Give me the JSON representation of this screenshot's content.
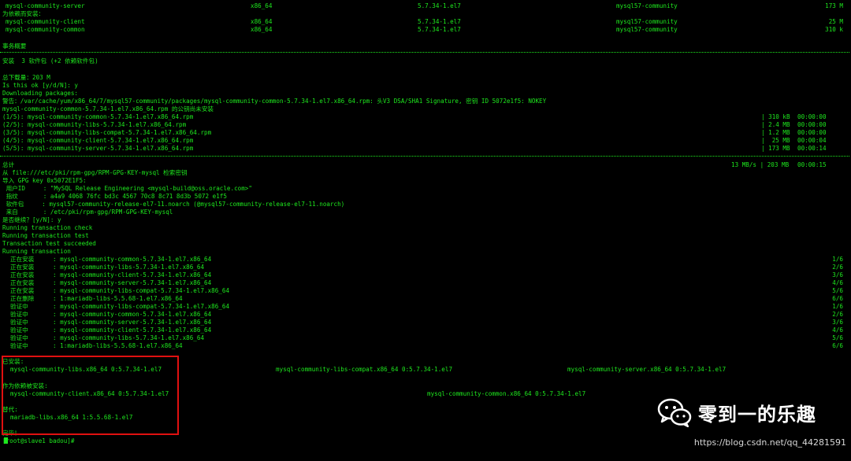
{
  "terminal": {
    "top_rows": [
      {
        "name": "mysql-community-server",
        "arch": "x86_64",
        "version": "5.7.34-1.el7",
        "repo": "mysql57-community",
        "size": "173 M"
      },
      {
        "section": "为依赖而安装："
      },
      {
        "name": "mysql-community-client",
        "arch": "x86_64",
        "version": "5.7.34-1.el7",
        "repo": "mysql57-community",
        "size": "25 M"
      },
      {
        "name": "mysql-community-common",
        "arch": "x86_64",
        "version": "5.7.34-1.el7",
        "repo": "mysql57-community",
        "size": "310 k"
      }
    ],
    "summary_title": "事务概要",
    "install_summary": "安装  3 软件包 (+2 依赖软件包)",
    "prelude": [
      "总下载量：203 M",
      "Is this ok [y/d/N]: y",
      "Downloading packages:",
      "警告：/var/cache/yum/x86_64/7/mysql57-community/packages/mysql-community-common-5.7.34-1.el7.x86_64.rpm: 头V3 DSA/SHA1 Signature, 密钥 ID 5072e1f5: NOKEY",
      "mysql-community-common-5.7.34-1.el7.x86_64.rpm 的公钥尚未安装"
    ],
    "downloads": [
      {
        "file": "(1/5): mysql-community-common-5.7.34-1.el7.x86_64.rpm",
        "size": "| 310 kB",
        "time": "00:00:00"
      },
      {
        "file": "(2/5): mysql-community-libs-5.7.34-1.el7.x86_64.rpm",
        "size": "| 2.4 MB",
        "time": "00:00:00"
      },
      {
        "file": "(3/5): mysql-community-libs-compat-5.7.34-1.el7.x86_64.rpm",
        "size": "| 1.2 MB",
        "time": "00:00:00"
      },
      {
        "file": "(4/5): mysql-community-client-5.7.34-1.el7.x86_64.rpm",
        "size": "|  25 MB",
        "time": "00:00:04"
      },
      {
        "file": "(5/5): mysql-community-server-5.7.34-1.el7.x86_64.rpm",
        "size": "| 173 MB",
        "time": "00:00:14"
      }
    ],
    "total": {
      "label": "总计",
      "size": "13 MB/s | 203 MB",
      "time": "00:00:15"
    },
    "gpg_lines": [
      "从 file:///etc/pki/rpm-gpg/RPM-GPG-KEY-mysql 检索密钥",
      "导入 GPG key 0x5072E1F5:",
      " 用户ID     : \"MySQL Release Engineering <mysql-build@oss.oracle.com>\"",
      " 指纹       : a4a9 4068 76fc bd3c 4567 70c8 8c71 8d3b 5072 e1f5",
      " 软件包     : mysql57-community-release-el7-11.noarch (@mysql57-community-release-el7-11.noarch)",
      " 来自       : /etc/pki/rpm-gpg/RPM-GPG-KEY-mysql",
      "是否继续？[y/N]: y",
      "Running transaction check",
      "Running transaction test",
      "Transaction test succeeded",
      "Running transaction"
    ],
    "transactions": [
      {
        "action": "正在安装",
        "pkg": ": mysql-community-common-5.7.34-1.el7.x86_64",
        "progress": "1/6"
      },
      {
        "action": "正在安装",
        "pkg": ": mysql-community-libs-5.7.34-1.el7.x86_64",
        "progress": "2/6"
      },
      {
        "action": "正在安装",
        "pkg": ": mysql-community-client-5.7.34-1.el7.x86_64",
        "progress": "3/6"
      },
      {
        "action": "正在安装",
        "pkg": ": mysql-community-server-5.7.34-1.el7.x86_64",
        "progress": "4/6"
      },
      {
        "action": "正在安装",
        "pkg": ": mysql-community-libs-compat-5.7.34-1.el7.x86_64",
        "progress": "5/6"
      },
      {
        "action": "正在删除",
        "pkg": ": 1:mariadb-libs-5.5.68-1.el7.x86_64",
        "progress": "6/6"
      },
      {
        "action": "验证中",
        "pkg": ": mysql-community-libs-compat-5.7.34-1.el7.x86_64",
        "progress": "1/6"
      },
      {
        "action": "验证中",
        "pkg": ": mysql-community-common-5.7.34-1.el7.x86_64",
        "progress": "2/6"
      },
      {
        "action": "验证中",
        "pkg": ": mysql-community-server-5.7.34-1.el7.x86_64",
        "progress": "3/6"
      },
      {
        "action": "验证中",
        "pkg": ": mysql-community-client-5.7.34-1.el7.x86_64",
        "progress": "4/6"
      },
      {
        "action": "验证中",
        "pkg": ": mysql-community-libs-5.7.34-1.el7.x86_64",
        "progress": "5/6"
      },
      {
        "action": "验证中",
        "pkg": ": 1:mariadb-libs-5.5.68-1.el7.x86_64",
        "progress": "6/6"
      }
    ],
    "installed": {
      "label": "已安装:",
      "items": [
        "mysql-community-libs.x86_64 0:5.7.34-1.el7",
        "mysql-community-libs-compat.x86_64 0:5.7.34-1.el7",
        "mysql-community-server.x86_64 0:5.7.34-1.el7"
      ]
    },
    "dependency_installed": {
      "label": "作为依赖被安装:",
      "items": [
        "mysql-community-client.x86_64 0:5.7.34-1.el7",
        "mysql-community-common.x86_64 0:5.7.34-1.el7"
      ]
    },
    "replaced": {
      "label": "替代:",
      "items": [
        "mariadb-libs.x86_64 1:5.5.68-1.el7"
      ]
    },
    "complete": "完毕！",
    "prompt": "[root@slave1 badou]# "
  },
  "watermark": {
    "text": "零到一的乐趣",
    "url": "https://blog.csdn.net/qq_44281591",
    "icon": "wechat-icon"
  },
  "colors": {
    "terminal_text": "#1ee81e",
    "background": "#000000",
    "highlight_border": "#e01010"
  }
}
